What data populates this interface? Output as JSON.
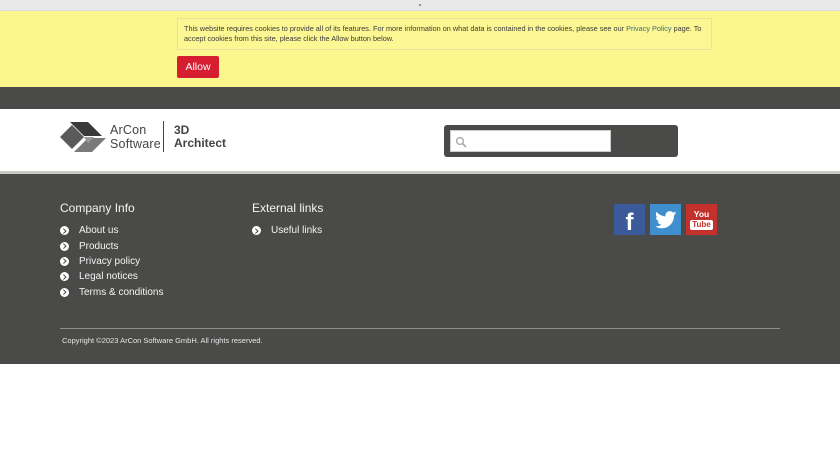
{
  "cookie_notice": {
    "text_before_link": "This website requires cookies to provide all of its features. For more information on what data is contained in the cookies, please see our ",
    "link_text": "Privacy Policy",
    "text_after_link": " page. To accept cookies from this site, please click the Allow button below.",
    "allow_label": "Allow"
  },
  "header": {
    "logo": {
      "word1": "ArCon",
      "word2": "Software",
      "product_line1": "3D",
      "product_line2": "Architect"
    },
    "search": {
      "placeholder": "",
      "value": "",
      "icon": "search-icon"
    }
  },
  "footer": {
    "company_info": {
      "title": "Company Info",
      "links": [
        "About us",
        "Products",
        "Privacy policy",
        "Legal notices",
        "Terms & conditions"
      ]
    },
    "external_links": {
      "title": "External links",
      "links": [
        "Useful links"
      ]
    },
    "social": {
      "facebook_glyph": "f",
      "youtube_top": "You",
      "youtube_bottom": "Tube"
    },
    "copyright": "Copyright ©2023 ArCon Software GmbH. All rights reserved."
  },
  "colors": {
    "cookie_bg": "#fbf68d",
    "allow_button": "#d51f31",
    "dark_band": "#4a4a48",
    "facebook": "#3b5a9a",
    "twitter": "#3f8fcf",
    "youtube": "#c4302b"
  }
}
